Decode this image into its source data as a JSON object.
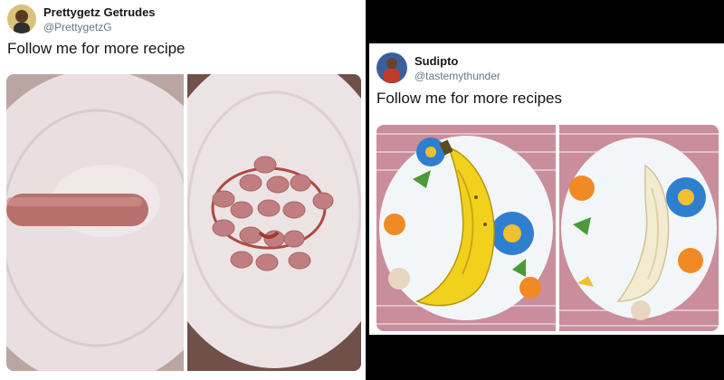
{
  "left_tweet": {
    "display_name": "Prettygetz Getrudes",
    "handle": "@PrettygetzG",
    "text": "Follow me for more recipe",
    "media": [
      "plate with a whole sausage",
      "plate with sliced sausage and ketchup"
    ]
  },
  "right_tweet": {
    "display_name": "Sudipto",
    "handle": "@tastemythunder",
    "text": "Follow me for more recipes",
    "media": [
      "floral plate with a whole banana",
      "floral plate with a peeled banana"
    ]
  },
  "colors": {
    "background": "#000000",
    "card": "#ffffff",
    "name_text": "#14171a",
    "handle_text": "#657786"
  }
}
